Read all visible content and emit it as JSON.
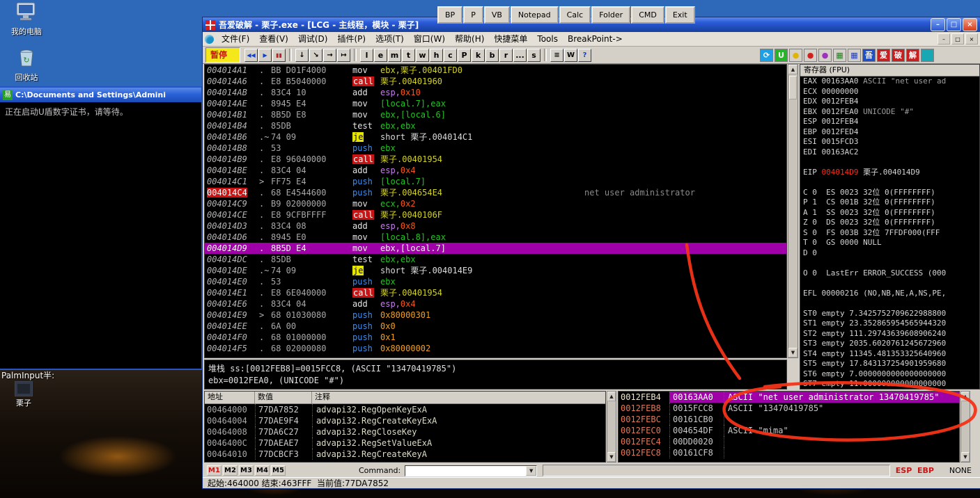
{
  "launcher": {
    "buttons": [
      "BP",
      "P",
      "VB",
      "Notepad",
      "Calc",
      "Folder",
      "CMD",
      "Exit"
    ]
  },
  "desktop": {
    "my_computer_label": "我的电脑",
    "recycle_bin_label": "回收站",
    "lizi_label": "栗子",
    "palm_input": "PalmInput半:"
  },
  "console": {
    "icon_glyph": "易",
    "title": "C:\\Documents and Settings\\Admini",
    "output": "正在启动U盾数字证书，请等待。"
  },
  "icons": {
    "scroll_up": "▲",
    "scroll_down": "▼",
    "dropdown_arrow": "▼"
  },
  "window": {
    "title": "吾爱破解 - 栗子.exe - [LCG -  主线程，模块 - 栗子]",
    "caption_glyphs": [
      "–",
      "□",
      "×"
    ],
    "menu": [
      "文件(F)",
      "查看(V)",
      "调试(D)",
      "插件(P)",
      "选项(T)",
      "窗口(W)",
      "帮助(H)",
      "快捷菜单",
      "Tools",
      "BreakPoint->"
    ],
    "toolbar": {
      "pause_label": "暂停",
      "transport": [
        {
          "name": "rewind",
          "glyph": "◀◀"
        },
        {
          "name": "run",
          "glyph": "▶"
        },
        {
          "name": "pause",
          "glyph": "▮▮"
        }
      ],
      "steps": [
        {
          "name": "step-into",
          "glyph": "↓"
        },
        {
          "name": "step-over",
          "glyph": "↘"
        },
        {
          "name": "animate-into",
          "glyph": "→"
        },
        {
          "name": "animate-over",
          "glyph": "↦"
        }
      ],
      "letter_buttons": [
        "l",
        "e",
        "m",
        "t",
        "w",
        "h",
        "c",
        "P",
        "k",
        "b",
        "r",
        "...",
        "s"
      ],
      "view_buttons": [
        {
          "name": "log",
          "glyph": "≡"
        },
        {
          "name": "watch",
          "glyph": "W"
        },
        {
          "name": "help",
          "glyph": "?"
        }
      ],
      "plugin_tiles": [
        {
          "name": "refresh-plugin-icon",
          "glyph": "⟳",
          "bg": "#1ea0e6",
          "fg": "#ffffff"
        },
        {
          "name": "green-u-plugin-icon",
          "glyph": "U",
          "bg": "#28b428",
          "fg": "#ffffff"
        },
        {
          "name": "yellow-dot-plugin-icon",
          "glyph": "●",
          "bg": "#d4d0c8",
          "fg": "#e0b400"
        },
        {
          "name": "red-dot-plugin-icon",
          "glyph": "●",
          "bg": "#d4d0c8",
          "fg": "#d02020"
        },
        {
          "name": "purple-dot-plugin-icon",
          "glyph": "●",
          "bg": "#d4d0c8",
          "fg": "#a030c0"
        },
        {
          "name": "green-grid-plugin-icon",
          "glyph": "▦",
          "bg": "#d4d0c8",
          "fg": "#208020"
        },
        {
          "name": "blue-grid-plugin-icon",
          "glyph": "▦",
          "bg": "#d4d0c8",
          "fg": "#2040c0"
        },
        {
          "name": "wu-tile-icon",
          "glyph": "吾",
          "bg": "#2050c8",
          "fg": "#ffffff"
        },
        {
          "name": "ai-tile-icon",
          "glyph": "爱",
          "bg": "#c82020",
          "fg": "#ffffff"
        },
        {
          "name": "po-tile-icon",
          "glyph": "破",
          "bg": "#c82020",
          "fg": "#ffffff"
        },
        {
          "name": "jie-tile-icon",
          "glyph": "解",
          "bg": "#c82020",
          "fg": "#ffffff"
        },
        {
          "name": "teal-tile-icon",
          "glyph": "",
          "bg": "#18a8b4",
          "fg": "#ffffff"
        }
      ]
    }
  },
  "disasm": {
    "rows": [
      {
        "a": "004014A1",
        "m": ".",
        "b": "BB D01F4000",
        "mn": "mov",
        "mc": "mov",
        "ops": [
          [
            "ebx,栗子.00401FD0",
            "y"
          ]
        ]
      },
      {
        "a": "004014A6",
        "m": ".",
        "b": "E8 B5040000",
        "mn": "call",
        "mc": "call",
        "ops": [
          [
            "栗子.00401960",
            "y"
          ]
        ]
      },
      {
        "a": "004014AB",
        "m": ".",
        "b": "83C4 10",
        "mn": "add",
        "mc": "mov",
        "ops": [
          [
            "esp,",
            "v"
          ],
          [
            "0x10",
            "o"
          ]
        ]
      },
      {
        "a": "004014AE",
        "m": ".",
        "b": "8945 E4",
        "mn": "mov",
        "mc": "mov",
        "ops": [
          [
            "[local.7],eax",
            "g"
          ]
        ]
      },
      {
        "a": "004014B1",
        "m": ".",
        "b": "8B5D E8",
        "mn": "mov",
        "mc": "mov",
        "ops": [
          [
            "ebx,[local.6]",
            "g"
          ]
        ]
      },
      {
        "a": "004014B4",
        "m": ".",
        "b": "85DB",
        "mn": "test",
        "mc": "mov",
        "ops": [
          [
            "ebx,ebx",
            "g"
          ]
        ]
      },
      {
        "a": "004014B6",
        "m": ".~",
        "b": "74 09",
        "mn": "je",
        "mc": "jcc",
        "ops": [
          [
            "short 栗子.004014C1",
            "w"
          ]
        ]
      },
      {
        "a": "004014B8",
        "m": ".",
        "b": "53",
        "mn": "push",
        "mc": "push",
        "ops": [
          [
            "ebx",
            "g"
          ]
        ]
      },
      {
        "a": "004014B9",
        "m": ".",
        "b": "E8 96040000",
        "mn": "call",
        "mc": "call",
        "ops": [
          [
            "栗子.00401954",
            "y"
          ]
        ]
      },
      {
        "a": "004014BE",
        "m": ".",
        "b": "83C4 04",
        "mn": "add",
        "mc": "mov",
        "ops": [
          [
            "esp,",
            "v"
          ],
          [
            "0x4",
            "o"
          ]
        ]
      },
      {
        "a": "004014C1",
        "m": ">",
        "b": "FF75 E4",
        "mn": "push",
        "mc": "push",
        "ops": [
          [
            "[local.7]",
            "g"
          ]
        ]
      },
      {
        "a": "004014C4",
        "m": ".",
        "b": "68 E4544600",
        "mn": "push",
        "mc": "push",
        "ops": [
          [
            "栗子.004654E4",
            "y"
          ]
        ],
        "bp": true,
        "cm": "net user administrator"
      },
      {
        "a": "004014C9",
        "m": ".",
        "b": "B9 02000000",
        "mn": "mov",
        "mc": "mov",
        "ops": [
          [
            "ecx,",
            "g"
          ],
          [
            "0x2",
            "o"
          ]
        ]
      },
      {
        "a": "004014CE",
        "m": ".",
        "b": "E8 9CFBFFFF",
        "mn": "call",
        "mc": "call",
        "ops": [
          [
            "栗子.0040106F",
            "y"
          ]
        ]
      },
      {
        "a": "004014D3",
        "m": ".",
        "b": "83C4 08",
        "mn": "add",
        "mc": "mov",
        "ops": [
          [
            "esp,",
            "v"
          ],
          [
            "0x8",
            "o"
          ]
        ]
      },
      {
        "a": "004014D6",
        "m": ".",
        "b": "8945 E0",
        "mn": "mov",
        "mc": "mov",
        "ops": [
          [
            "[local.8],eax",
            "g"
          ]
        ]
      },
      {
        "a": "004014D9",
        "m": ".",
        "b": "8B5D E4",
        "mn": "mov",
        "mc": "mov",
        "ops": [
          [
            "ebx,[local.7]",
            "g"
          ]
        ],
        "sel": true
      },
      {
        "a": "004014DC",
        "m": ".",
        "b": "85DB",
        "mn": "test",
        "mc": "mov",
        "ops": [
          [
            "ebx,ebx",
            "g"
          ]
        ]
      },
      {
        "a": "004014DE",
        "m": ".~",
        "b": "74 09",
        "mn": "je",
        "mc": "jcc",
        "ops": [
          [
            "short 栗子.004014E9",
            "w"
          ]
        ]
      },
      {
        "a": "004014E0",
        "m": ".",
        "b": "53",
        "mn": "push",
        "mc": "push",
        "ops": [
          [
            "ebx",
            "g"
          ]
        ]
      },
      {
        "a": "004014E1",
        "m": ".",
        "b": "E8 6E040000",
        "mn": "call",
        "mc": "call",
        "ops": [
          [
            "栗子.00401954",
            "y"
          ]
        ]
      },
      {
        "a": "004014E6",
        "m": ".",
        "b": "83C4 04",
        "mn": "add",
        "mc": "mov",
        "ops": [
          [
            "esp,",
            "v"
          ],
          [
            "0x4",
            "o"
          ]
        ]
      },
      {
        "a": "004014E9",
        "m": ">",
        "b": "68 01030080",
        "mn": "push",
        "mc": "push",
        "ops": [
          [
            "0x80000301",
            "n"
          ]
        ]
      },
      {
        "a": "004014EE",
        "m": ".",
        "b": "6A 00",
        "mn": "push",
        "mc": "push",
        "ops": [
          [
            "0x0",
            "n"
          ]
        ]
      },
      {
        "a": "004014F0",
        "m": ".",
        "b": "68 01000000",
        "mn": "push",
        "mc": "push",
        "ops": [
          [
            "0x1",
            "n"
          ]
        ]
      },
      {
        "a": "004014F5",
        "m": ".",
        "b": "68 02000080",
        "mn": "push",
        "mc": "push",
        "ops": [
          [
            "0x80000002",
            "n"
          ]
        ]
      }
    ]
  },
  "info": {
    "line1": "堆栈 ss:[0012FEB8]=0015FCC8, (ASCII \"13470419785\")",
    "line2": "ebx=0012FEA0, (UNICODE \"#\")"
  },
  "registers": {
    "title": "寄存器 (FPU)",
    "rows": [
      [
        [
          "EAX 00163AA0 "
        ],
        [
          "ASCII \"net user ad",
          "dim"
        ]
      ],
      [
        [
          "ECX 00000000"
        ]
      ],
      [
        [
          "EDX 0012FEB4"
        ]
      ],
      [
        [
          "EBX 0012FEA0 "
        ],
        [
          "UNICODE \"#\"",
          "dim"
        ]
      ],
      [
        [
          "ESP 0012FEB4"
        ]
      ],
      [
        [
          "EBP 0012FED4"
        ]
      ],
      [
        [
          "ESI 0015FCD3"
        ]
      ],
      [
        [
          "EDI 00163AC2"
        ]
      ],
      [
        [
          ""
        ]
      ],
      [
        [
          "EIP "
        ],
        [
          "004014D9",
          "red"
        ],
        [
          " 栗子.004014D9"
        ]
      ],
      [
        [
          ""
        ]
      ],
      [
        [
          "C 0  ES 0023 32位 0(FFFFFFFF)"
        ]
      ],
      [
        [
          "P 1  CS 001B 32位 0(FFFFFFFF)"
        ]
      ],
      [
        [
          "A 1  SS 0023 32位 0(FFFFFFFF)"
        ]
      ],
      [
        [
          "Z 0  DS 0023 32位 0(FFFFFFFF)"
        ]
      ],
      [
        [
          "S 0  FS 003B 32位 7FFDF000(FFF"
        ]
      ],
      [
        [
          "T 0  GS 0000 NULL"
        ]
      ],
      [
        [
          "D 0"
        ]
      ],
      [
        [
          ""
        ]
      ],
      [
        [
          "O 0  LastErr ERROR_SUCCESS (000"
        ]
      ],
      [
        [
          ""
        ]
      ],
      [
        [
          "EFL 00000216 (NO,NB,NE,A,NS,PE,"
        ]
      ],
      [
        [
          ""
        ]
      ],
      [
        [
          "ST0 empty 7.3425752709622988800"
        ]
      ],
      [
        [
          "ST1 empty 23.352865954565944320"
        ]
      ],
      [
        [
          "ST2 empty 111.29743639608906240"
        ]
      ],
      [
        [
          "ST3 empty 2035.6020761245672960"
        ]
      ],
      [
        [
          "ST4 empty 11345.481353325640960"
        ]
      ],
      [
        [
          "ST5 empty 17.843137254901959680"
        ]
      ],
      [
        [
          "ST6 empty 7.0000000000000000000"
        ]
      ],
      [
        [
          "ST7 empty 11.000000000000000000"
        ]
      ]
    ]
  },
  "dump": {
    "headers": [
      "地址",
      "数值",
      "注释"
    ],
    "rows": [
      [
        "00464000",
        "77DA7852",
        "advapi32.RegOpenKeyExA"
      ],
      [
        "00464004",
        "77DAE9F4",
        "advapi32.RegCreateKeyExA"
      ],
      [
        "00464008",
        "77DA6C27",
        "advapi32.RegCloseKey"
      ],
      [
        "0046400C",
        "77DAEAE7",
        "advapi32.RegSetValueExA"
      ],
      [
        "00464010",
        "77DCBCF3",
        "advapi32.RegCreateKeyA"
      ]
    ]
  },
  "stack": {
    "rows": [
      {
        "a": "0012FEB4",
        "v": "00163AA0",
        "c": "ASCII \"net user administrator 13470419785\"",
        "sel": true
      },
      {
        "a": "0012FEB8",
        "v": "0015FCC8",
        "c": "ASCII \"13470419785\""
      },
      {
        "a": "0012FEBC",
        "v": "00161CB0",
        "c": ""
      },
      {
        "a": "0012FEC0",
        "v": "004654DF",
        "c": "ASCII \"mima\""
      },
      {
        "a": "0012FEC4",
        "v": "00DD0020",
        "c": ""
      },
      {
        "a": "0012FEC8",
        "v": "00161CF8",
        "c": ""
      }
    ]
  },
  "command_bar": {
    "m_buttons": [
      "M1",
      "M2",
      "M3",
      "M4",
      "M5"
    ],
    "label": "Command:",
    "right_regs": "ESP  EBP",
    "right_status": "NONE"
  },
  "status_bar": {
    "text": "起始:464000 结束:463FFF  当前值:77DA7852"
  },
  "colors": {
    "selection_purple": "#a000a8",
    "breakpoint_red": "#cc1212",
    "annotation_red": "#f43318"
  }
}
